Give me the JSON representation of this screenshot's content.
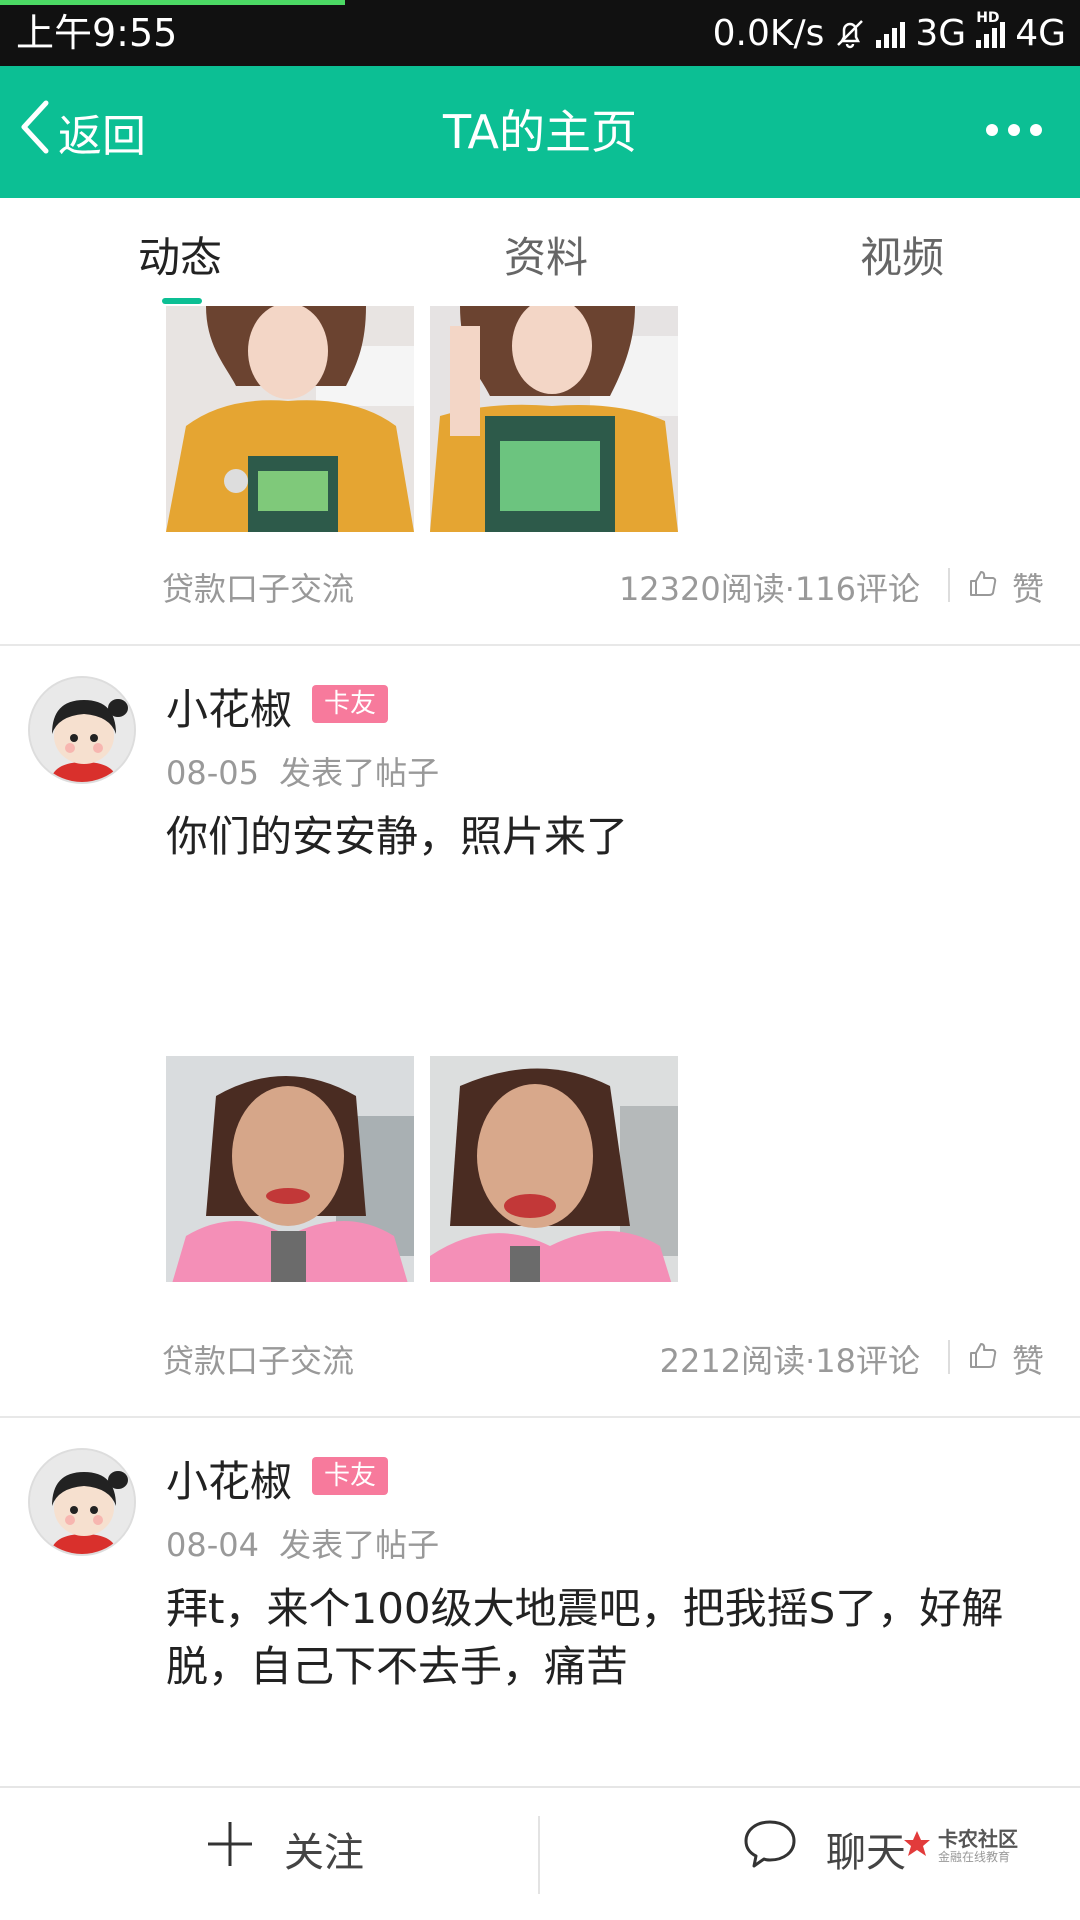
{
  "status_bar": {
    "time": "上午9:55",
    "net_speed": "0.0K/s",
    "net1": "3G",
    "net2_hd": "HD",
    "net2": "4G"
  },
  "header": {
    "back_label": "返回",
    "title": "TA的主页"
  },
  "tabs": [
    {
      "label": "动态",
      "active": true
    },
    {
      "label": "资料",
      "active": false
    },
    {
      "label": "视频",
      "active": false
    }
  ],
  "posts": [
    {
      "category": "贷款口子交流",
      "stats": "12320阅读·116评论",
      "like_label": "赞"
    },
    {
      "username": "小花椒",
      "badge": "卡友",
      "date": "08-05",
      "action": "发表了帖子",
      "content": "你们的安安静，照片来了",
      "category": "贷款口子交流",
      "stats": "2212阅读·18评论",
      "like_label": "赞"
    },
    {
      "username": "小花椒",
      "badge": "卡友",
      "date": "08-04",
      "action": "发表了帖子",
      "content": "拜t，来个100级大地震吧，把我摇S了，好解脱，自己下不去手，痛苦"
    }
  ],
  "bottom_bar": {
    "follow_label": "关注",
    "chat_label": "聊天"
  },
  "watermark": {
    "title": "卡农社区",
    "subtitle": "金融在线教育"
  },
  "colors": {
    "accent": "#0cbf94",
    "badge": "#f77a9c"
  }
}
